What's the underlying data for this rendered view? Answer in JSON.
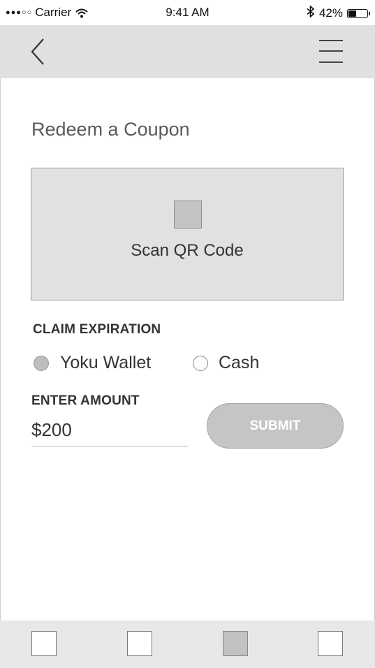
{
  "status_bar": {
    "carrier": "Carrier",
    "signal_dots": "●●●○○",
    "time": "9:41 AM",
    "battery_percent": "42%",
    "battery_level": 0.42
  },
  "nav": {
    "back_icon": "chevron-left-icon",
    "menu_icon": "hamburger-menu-icon"
  },
  "page": {
    "title": "Redeem a Coupon"
  },
  "scan": {
    "label": "Scan QR Code",
    "icon": "qr-code-icon"
  },
  "claim": {
    "heading": "CLAIM EXPIRATION",
    "options": [
      {
        "label": "Yoku Wallet",
        "selected": true
      },
      {
        "label": "Cash",
        "selected": false
      }
    ]
  },
  "amount": {
    "heading": "ENTER AMOUNT",
    "value": "$200"
  },
  "submit": {
    "label": "SUBMIT"
  },
  "tabbar": {
    "tabs": [
      {
        "name": "tab-1",
        "active": false
      },
      {
        "name": "tab-2",
        "active": false
      },
      {
        "name": "tab-3",
        "active": true
      },
      {
        "name": "tab-4",
        "active": false
      }
    ]
  },
  "colors": {
    "nav_background": "#e0e0e0",
    "scan_background": "#e1e1e1",
    "submit_background": "#c5c5c5",
    "text": "#333333"
  }
}
